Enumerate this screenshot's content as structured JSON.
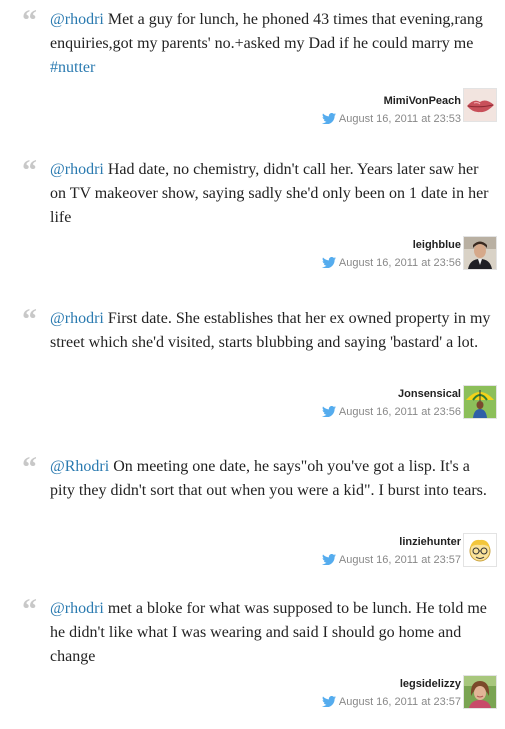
{
  "tweets": [
    {
      "mention": "@rhodri",
      "text": " Met a guy for lunch, he phoned 43 times that evening,rang enquiries,got my parents' no.+asked my Dad if he could marry me ",
      "hashtag": "#nutter",
      "author": "MimiVonPeach",
      "timestamp": "August 16, 2011 at 23:53",
      "avatar_icon": "lips-avatar"
    },
    {
      "mention": "@rhodri",
      "text": " Had date, no chemistry, didn't call her. Years later saw her on TV makeover show, saying sadly she'd only been on 1 date in her life",
      "hashtag": "",
      "author": "leighblue",
      "timestamp": "August 16, 2011 at 23:56",
      "avatar_icon": "man-avatar"
    },
    {
      "mention": "@rhodri",
      "text": " First date. She establishes that her ex owned property in my street which she'd visited, starts blubbing and saying 'bastard' a lot.",
      "hashtag": "",
      "author": "Jonsensical",
      "timestamp": "August 16, 2011 at 23:56",
      "avatar_icon": "umbrella-avatar"
    },
    {
      "mention": "@Rhodri",
      "text": " On meeting one date, he says\"oh you've got a lisp. It's a pity they didn't sort that out when you were a kid\". I burst into tears.",
      "hashtag": "",
      "author": "linziehunter",
      "timestamp": "August 16, 2011 at 23:57",
      "avatar_icon": "cartoon-face-avatar"
    },
    {
      "mention": "@rhodri",
      "text": " met a bloke for what was supposed to be lunch. He told me he didn't like what I was wearing and said I should go home and change",
      "hashtag": "",
      "author": "legsidelizzy",
      "timestamp": "August 16, 2011 at 23:57",
      "avatar_icon": "woman-avatar"
    }
  ]
}
